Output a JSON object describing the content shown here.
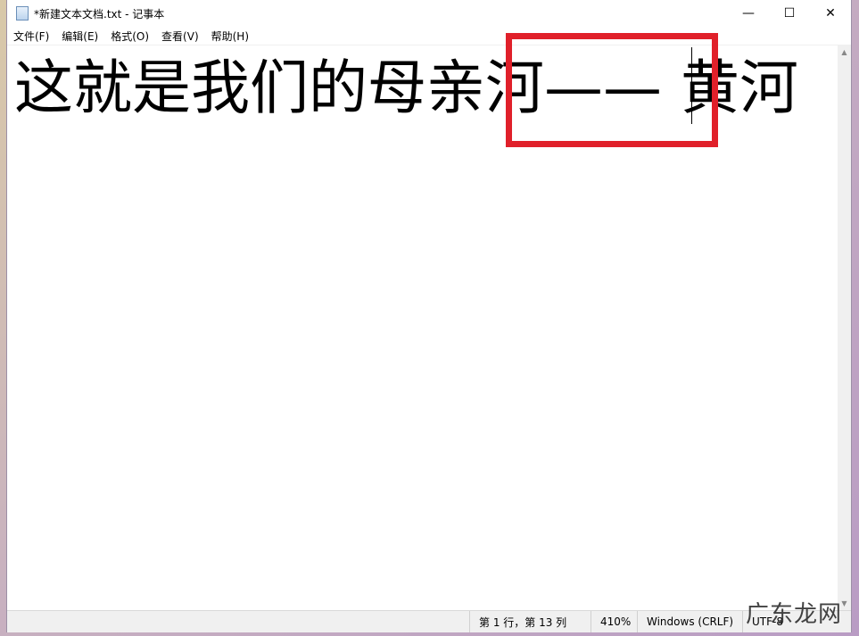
{
  "window": {
    "title": "*新建文本文档.txt - 记事本",
    "controls": {
      "minimize": "—",
      "maximize": "☐",
      "close": "✕"
    }
  },
  "menu": [
    "文件(F)",
    "编辑(E)",
    "格式(O)",
    "查看(V)",
    "帮助(H)"
  ],
  "editor": {
    "text": "这就是我们的母亲河—— 黄河"
  },
  "statusbar": {
    "position": "第 1 行，第 13 列",
    "zoom": "410%",
    "line_ending": "Windows (CRLF)",
    "encoding": "UTF-8"
  },
  "annotation": {
    "highlight_color": "#e0202a"
  },
  "watermark": "广东龙网"
}
